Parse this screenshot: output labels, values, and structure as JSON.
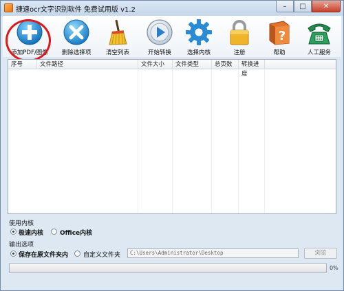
{
  "window": {
    "title": "捷速ocr文字识别软件 免费试用版 v1.2",
    "minimize_glyph": "–",
    "maximize_glyph": "□",
    "close_glyph": "✕"
  },
  "toolbar": {
    "items": [
      {
        "label": "添加PDF/图像",
        "icon": "add-icon"
      },
      {
        "label": "删除选择项",
        "icon": "delete-icon"
      },
      {
        "label": "清空列表",
        "icon": "broom-icon"
      },
      {
        "label": "开始转换",
        "icon": "play-icon"
      },
      {
        "label": "选择内核",
        "icon": "gear-icon"
      },
      {
        "label": "注册",
        "icon": "lock-icon"
      },
      {
        "label": "帮助",
        "icon": "help-book-icon"
      },
      {
        "label": "人工服务",
        "icon": "phone-icon"
      }
    ]
  },
  "file_list": {
    "columns": [
      "序号",
      "文件路径",
      "文件大小",
      "文件类型",
      "总页数",
      "转换进度"
    ],
    "rows": []
  },
  "engine": {
    "section_label": "使用内核",
    "options": [
      {
        "label": "极速内核",
        "selected": true
      },
      {
        "label": "Office内核",
        "selected": false
      }
    ]
  },
  "output": {
    "section_label": "输出选项",
    "options": [
      {
        "label": "保存在原文件夹内",
        "selected": true
      },
      {
        "label": "自定义文件夹",
        "selected": false
      }
    ],
    "path_value": "C:\\Users\\Administrator\\Desktop",
    "browse_label": "浏览"
  },
  "progress": {
    "value": 0,
    "text": "0%"
  },
  "colors": {
    "highlight_ring": "#e0161a",
    "add_button": "#1e8fd6",
    "delete_button": "#2a9ad8"
  }
}
